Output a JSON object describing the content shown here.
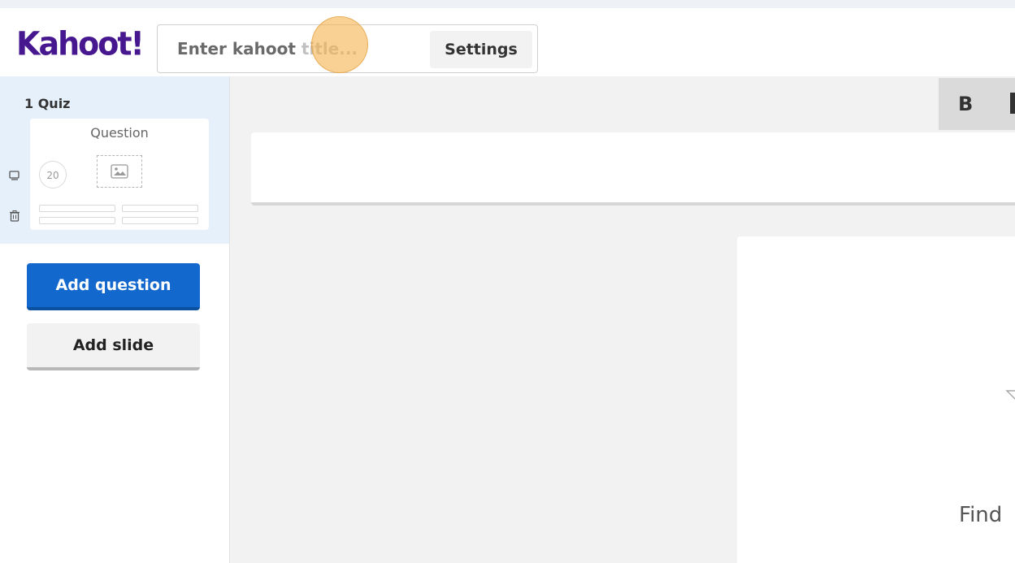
{
  "app": {
    "logo_text": "Kahoot!"
  },
  "header": {
    "title_input": {
      "placeholder_main": "Enter kahoot ",
      "placeholder_faint": "title..."
    },
    "settings_label": "Settings"
  },
  "sidebar": {
    "quiz_label": "1  Quiz",
    "thumbnail": {
      "title": "Question",
      "timer": "20"
    },
    "add_question_label": "Add question",
    "add_slide_label": "Add slide"
  },
  "editor": {
    "bold_label": "B",
    "media_text": "Find"
  },
  "colors": {
    "brand": "#46178f",
    "primary_button": "#1368ce",
    "click_marker": "#f7b34c"
  },
  "icons": {
    "duplicate": "duplicate-icon",
    "delete": "trash-icon",
    "image": "image-icon"
  }
}
